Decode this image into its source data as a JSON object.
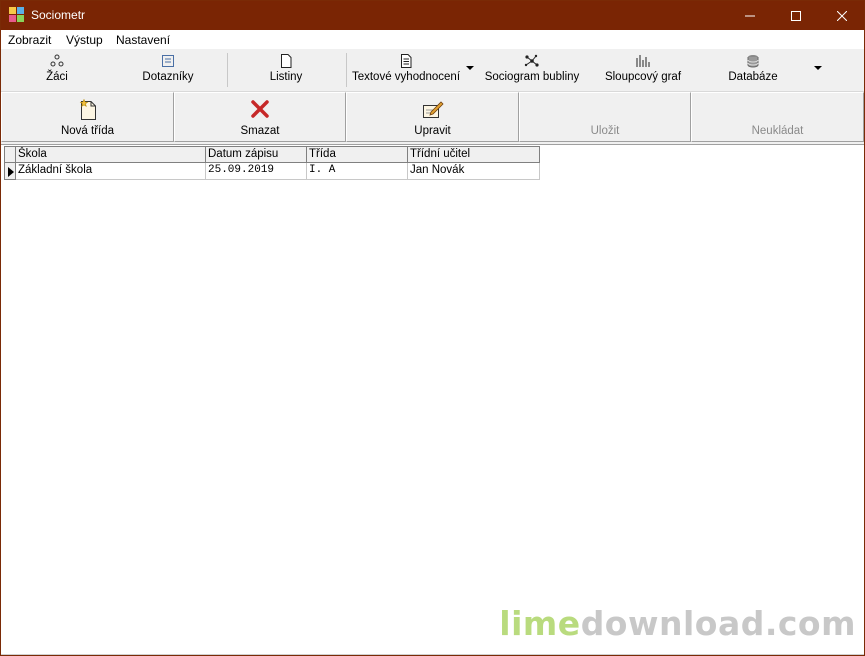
{
  "window": {
    "title": "Sociometr",
    "controls": {
      "minimize": "minimize-icon",
      "maximize": "maximize-icon",
      "close": "close-icon"
    },
    "titlebar_color": "#7a2504"
  },
  "menu": {
    "items": [
      {
        "label": "Zobrazit"
      },
      {
        "label": "Výstup"
      },
      {
        "label": "Nastavení"
      }
    ]
  },
  "toolbar": {
    "items": [
      {
        "label": "Žáci",
        "icon": "students-icon"
      },
      {
        "label": "Dotazníky",
        "icon": "questionnaire-icon"
      },
      {
        "label": "Listiny",
        "icon": "document-icon"
      },
      {
        "label": "Textové vyhodnocení",
        "icon": "text-report-icon",
        "dropdown": true
      },
      {
        "label": "Sociogram bubliny",
        "icon": "sociogram-icon"
      },
      {
        "label": "Sloupcový graf",
        "icon": "bar-chart-icon"
      },
      {
        "label": "Databáze",
        "icon": "database-icon",
        "dropdown": true
      }
    ]
  },
  "actions": {
    "new_class": {
      "label": "Nová třída",
      "icon": "new-document-icon",
      "enabled": true
    },
    "delete": {
      "label": "Smazat",
      "icon": "delete-x-icon",
      "enabled": true
    },
    "edit": {
      "label": "Upravit",
      "icon": "edit-pencil-icon",
      "enabled": true
    },
    "save": {
      "label": "Uložit",
      "enabled": false
    },
    "discard": {
      "label": "Neukládat",
      "enabled": false
    }
  },
  "grid": {
    "columns": [
      "Škola",
      "Datum zápisu",
      "Třída",
      "Třídní učitel"
    ],
    "rows": [
      {
        "school": "Základní škola",
        "date": "25.09.2019",
        "class": "I. A",
        "teacher": "Jan Novák",
        "current": true
      }
    ]
  },
  "watermark": {
    "part1": "lime",
    "part2": "download.com"
  }
}
